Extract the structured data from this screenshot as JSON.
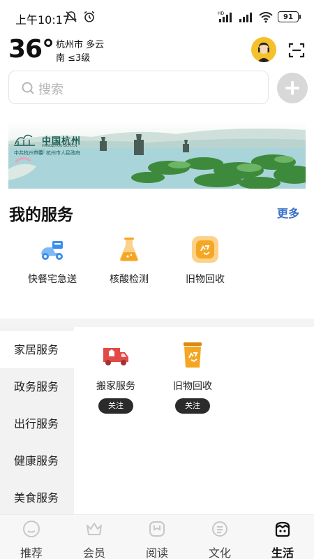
{
  "status_bar": {
    "time": "上午10:17",
    "battery": "91"
  },
  "weather": {
    "temperature": "36°",
    "city_condition": "杭州市 多云",
    "wind": "南 ≤3级"
  },
  "search": {
    "placeholder": "搜索"
  },
  "banner": {
    "title": "中国杭州",
    "subtitle": "HANGZHOU.GOV.CN",
    "org_left": "中共杭州市委",
    "org_right": "杭州市人民政府"
  },
  "my_services": {
    "title": "我的服务",
    "more": "更多",
    "items": [
      {
        "label": "快餐宅急送",
        "icon": "delivery-scooter-icon"
      },
      {
        "label": "核酸检测",
        "icon": "test-flask-icon"
      },
      {
        "label": "旧物回收",
        "icon": "recycle-icon"
      }
    ]
  },
  "categories": {
    "items": [
      "家居服务",
      "政务服务",
      "出行服务",
      "健康服务",
      "美食服务"
    ],
    "active_index": 0
  },
  "category_services": [
    {
      "label": "搬家服务",
      "icon": "moving-truck-icon",
      "action": "关注"
    },
    {
      "label": "旧物回收",
      "icon": "recycle-bin-icon",
      "action": "关注"
    }
  ],
  "tabs": [
    {
      "label": "推荐",
      "icon": "recommend-icon"
    },
    {
      "label": "会员",
      "icon": "crown-icon"
    },
    {
      "label": "阅读",
      "icon": "read-icon"
    },
    {
      "label": "文化",
      "icon": "culture-icon"
    },
    {
      "label": "生活",
      "icon": "life-icon"
    }
  ],
  "active_tab": 4,
  "colors": {
    "accent_link": "#3a70c8",
    "icon_blue": "#3d8ef0",
    "icon_orange": "#f5a623",
    "truck_red": "#e24a48"
  }
}
